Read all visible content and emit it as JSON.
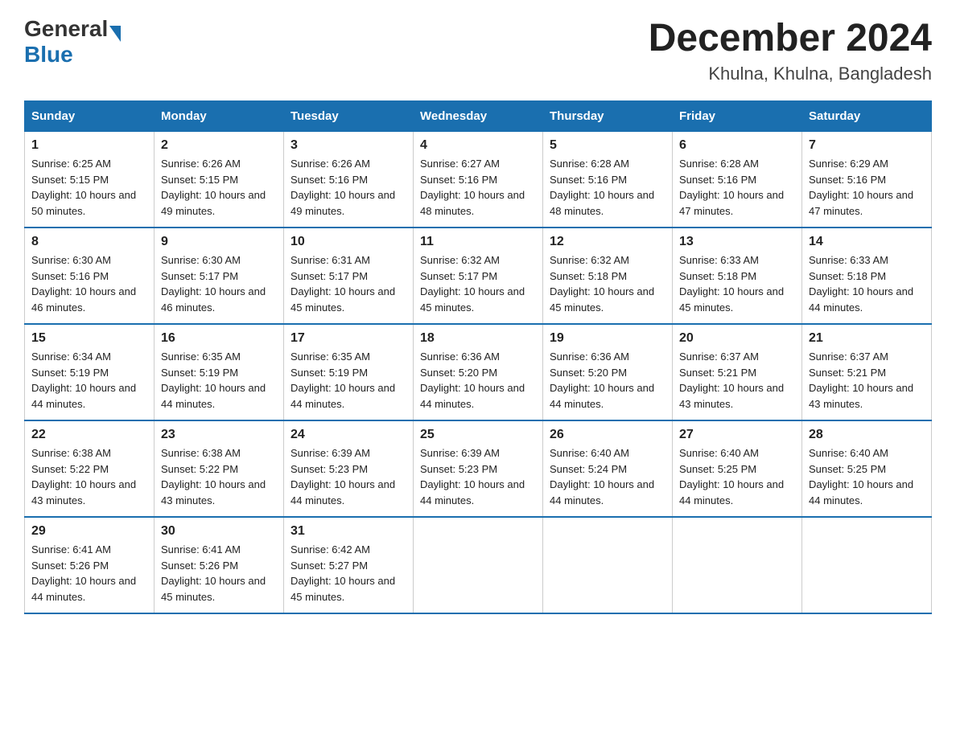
{
  "logo": {
    "general": "General",
    "blue": "Blue"
  },
  "title": "December 2024",
  "subtitle": "Khulna, Khulna, Bangladesh",
  "days_header": [
    "Sunday",
    "Monday",
    "Tuesday",
    "Wednesday",
    "Thursday",
    "Friday",
    "Saturday"
  ],
  "weeks": [
    [
      {
        "num": "1",
        "sunrise": "6:25 AM",
        "sunset": "5:15 PM",
        "daylight": "10 hours and 50 minutes."
      },
      {
        "num": "2",
        "sunrise": "6:26 AM",
        "sunset": "5:15 PM",
        "daylight": "10 hours and 49 minutes."
      },
      {
        "num": "3",
        "sunrise": "6:26 AM",
        "sunset": "5:16 PM",
        "daylight": "10 hours and 49 minutes."
      },
      {
        "num": "4",
        "sunrise": "6:27 AM",
        "sunset": "5:16 PM",
        "daylight": "10 hours and 48 minutes."
      },
      {
        "num": "5",
        "sunrise": "6:28 AM",
        "sunset": "5:16 PM",
        "daylight": "10 hours and 48 minutes."
      },
      {
        "num": "6",
        "sunrise": "6:28 AM",
        "sunset": "5:16 PM",
        "daylight": "10 hours and 47 minutes."
      },
      {
        "num": "7",
        "sunrise": "6:29 AM",
        "sunset": "5:16 PM",
        "daylight": "10 hours and 47 minutes."
      }
    ],
    [
      {
        "num": "8",
        "sunrise": "6:30 AM",
        "sunset": "5:16 PM",
        "daylight": "10 hours and 46 minutes."
      },
      {
        "num": "9",
        "sunrise": "6:30 AM",
        "sunset": "5:17 PM",
        "daylight": "10 hours and 46 minutes."
      },
      {
        "num": "10",
        "sunrise": "6:31 AM",
        "sunset": "5:17 PM",
        "daylight": "10 hours and 45 minutes."
      },
      {
        "num": "11",
        "sunrise": "6:32 AM",
        "sunset": "5:17 PM",
        "daylight": "10 hours and 45 minutes."
      },
      {
        "num": "12",
        "sunrise": "6:32 AM",
        "sunset": "5:18 PM",
        "daylight": "10 hours and 45 minutes."
      },
      {
        "num": "13",
        "sunrise": "6:33 AM",
        "sunset": "5:18 PM",
        "daylight": "10 hours and 45 minutes."
      },
      {
        "num": "14",
        "sunrise": "6:33 AM",
        "sunset": "5:18 PM",
        "daylight": "10 hours and 44 minutes."
      }
    ],
    [
      {
        "num": "15",
        "sunrise": "6:34 AM",
        "sunset": "5:19 PM",
        "daylight": "10 hours and 44 minutes."
      },
      {
        "num": "16",
        "sunrise": "6:35 AM",
        "sunset": "5:19 PM",
        "daylight": "10 hours and 44 minutes."
      },
      {
        "num": "17",
        "sunrise": "6:35 AM",
        "sunset": "5:19 PM",
        "daylight": "10 hours and 44 minutes."
      },
      {
        "num": "18",
        "sunrise": "6:36 AM",
        "sunset": "5:20 PM",
        "daylight": "10 hours and 44 minutes."
      },
      {
        "num": "19",
        "sunrise": "6:36 AM",
        "sunset": "5:20 PM",
        "daylight": "10 hours and 44 minutes."
      },
      {
        "num": "20",
        "sunrise": "6:37 AM",
        "sunset": "5:21 PM",
        "daylight": "10 hours and 43 minutes."
      },
      {
        "num": "21",
        "sunrise": "6:37 AM",
        "sunset": "5:21 PM",
        "daylight": "10 hours and 43 minutes."
      }
    ],
    [
      {
        "num": "22",
        "sunrise": "6:38 AM",
        "sunset": "5:22 PM",
        "daylight": "10 hours and 43 minutes."
      },
      {
        "num": "23",
        "sunrise": "6:38 AM",
        "sunset": "5:22 PM",
        "daylight": "10 hours and 43 minutes."
      },
      {
        "num": "24",
        "sunrise": "6:39 AM",
        "sunset": "5:23 PM",
        "daylight": "10 hours and 44 minutes."
      },
      {
        "num": "25",
        "sunrise": "6:39 AM",
        "sunset": "5:23 PM",
        "daylight": "10 hours and 44 minutes."
      },
      {
        "num": "26",
        "sunrise": "6:40 AM",
        "sunset": "5:24 PM",
        "daylight": "10 hours and 44 minutes."
      },
      {
        "num": "27",
        "sunrise": "6:40 AM",
        "sunset": "5:25 PM",
        "daylight": "10 hours and 44 minutes."
      },
      {
        "num": "28",
        "sunrise": "6:40 AM",
        "sunset": "5:25 PM",
        "daylight": "10 hours and 44 minutes."
      }
    ],
    [
      {
        "num": "29",
        "sunrise": "6:41 AM",
        "sunset": "5:26 PM",
        "daylight": "10 hours and 44 minutes."
      },
      {
        "num": "30",
        "sunrise": "6:41 AM",
        "sunset": "5:26 PM",
        "daylight": "10 hours and 45 minutes."
      },
      {
        "num": "31",
        "sunrise": "6:42 AM",
        "sunset": "5:27 PM",
        "daylight": "10 hours and 45 minutes."
      },
      {
        "num": "",
        "sunrise": "",
        "sunset": "",
        "daylight": ""
      },
      {
        "num": "",
        "sunrise": "",
        "sunset": "",
        "daylight": ""
      },
      {
        "num": "",
        "sunrise": "",
        "sunset": "",
        "daylight": ""
      },
      {
        "num": "",
        "sunrise": "",
        "sunset": "",
        "daylight": ""
      }
    ]
  ]
}
